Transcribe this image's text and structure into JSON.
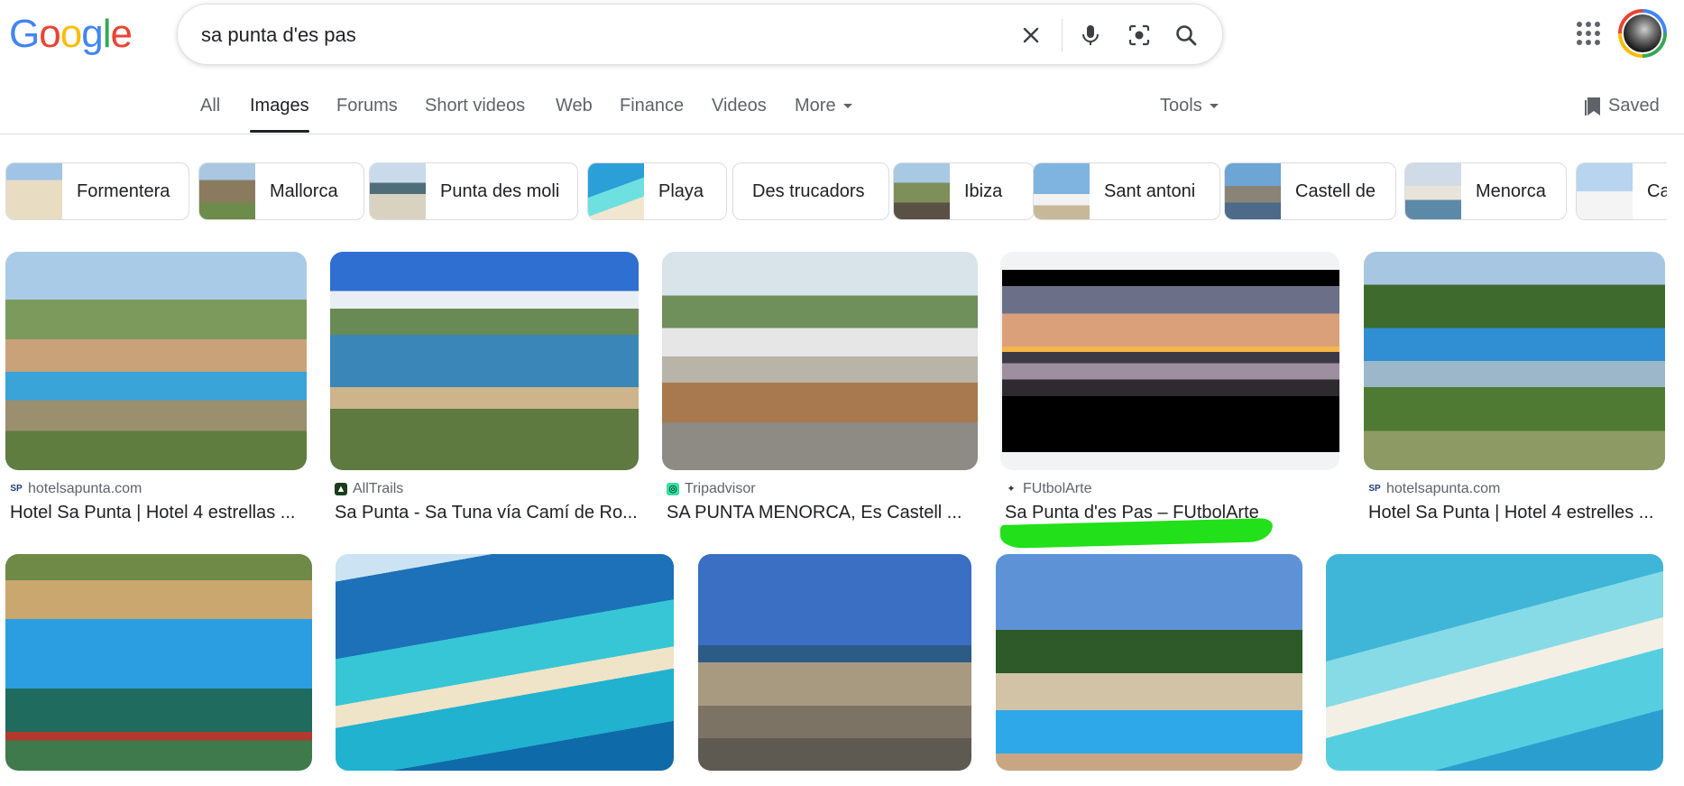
{
  "logo": [
    "G",
    "o",
    "o",
    "g",
    "l",
    "e"
  ],
  "logo_colors": [
    "#4285f4",
    "#ea4335",
    "#fbbc05",
    "#4285f4",
    "#34a853",
    "#ea4335"
  ],
  "search": {
    "query": "sa punta d'es pas"
  },
  "tabs": [
    {
      "label": "All"
    },
    {
      "label": "Images"
    },
    {
      "label": "Forums"
    },
    {
      "label": "Short videos"
    },
    {
      "label": "Web"
    },
    {
      "label": "Finance"
    },
    {
      "label": "Videos"
    },
    {
      "label": "More"
    },
    {
      "label": "Tools"
    }
  ],
  "saved_label": "Saved",
  "chips": [
    {
      "label": "Formentera"
    },
    {
      "label": "Mallorca"
    },
    {
      "label": "Punta des moli"
    },
    {
      "label": "Playa"
    },
    {
      "label": "Des trucadors"
    },
    {
      "label": "Ibiza"
    },
    {
      "label": "Sant antoni"
    },
    {
      "label": "Castell de"
    },
    {
      "label": "Menorca"
    },
    {
      "label": "Ca"
    }
  ],
  "results": [
    {
      "source": "hotelsapunta.com",
      "title": "Hotel Sa Punta | Hotel 4 estrellas ...",
      "favicon": "SP"
    },
    {
      "source": "AllTrails",
      "title": "Sa Punta - Sa Tuna vía Camí de Ro...",
      "favicon": "▲"
    },
    {
      "source": "Tripadvisor",
      "title": "SA PUNTA MENORCA, Es Castell ...",
      "favicon": "◎"
    },
    {
      "source": "FUtbolArte",
      "title": "Sa Punta d'es Pas – FUtbolArte",
      "favicon": "✦"
    },
    {
      "source": "hotelsapunta.com",
      "title": "Hotel Sa Punta | Hotel 4 estrelles ...",
      "favicon": "SP"
    }
  ],
  "colors": {
    "accent": "#1a73e8",
    "highlight": "#22e01a",
    "text": "#202124",
    "muted": "#5f6368"
  }
}
